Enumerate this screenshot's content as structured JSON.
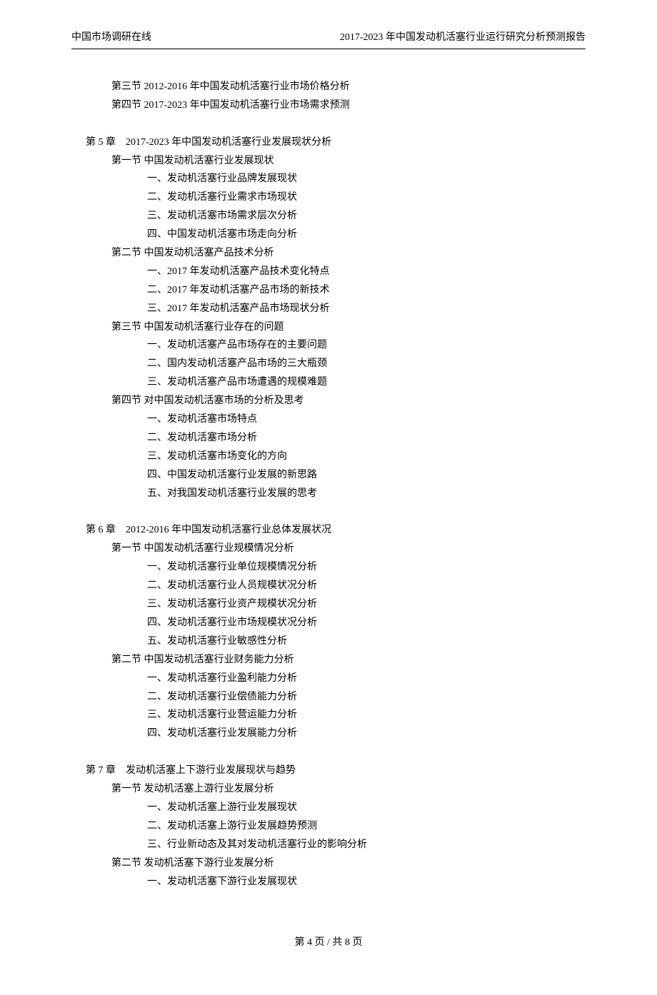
{
  "header": {
    "left": "中国市场调研在线",
    "right": "2017-2023 年中国发动机活塞行业运行研究分析预测报告"
  },
  "prelude": [
    {
      "type": "section",
      "text": "第三节 2012-2016 年中国发动机活塞行业市场价格分析"
    },
    {
      "type": "section",
      "text": "第四节 2017-2023 年中国发动机活塞行业市场需求预测"
    }
  ],
  "chapters": [
    {
      "title": "第 5 章　2017-2023 年中国发动机活塞行业发展现状分析",
      "sections": [
        {
          "title": "第一节 中国发动机活塞行业发展现状",
          "items": [
            "一、发动机活塞行业品牌发展现状",
            "二、发动机活塞行业需求市场现状",
            "三、发动机活塞市场需求层次分析",
            "四、中国发动机活塞市场走向分析"
          ]
        },
        {
          "title": "第二节 中国发动机活塞产品技术分析",
          "items": [
            "一、2017 年发动机活塞产品技术变化特点",
            "二、2017 年发动机活塞产品市场的新技术",
            "三、2017 年发动机活塞产品市场现状分析"
          ]
        },
        {
          "title": "第三节 中国发动机活塞行业存在的问题",
          "items": [
            "一、发动机活塞产品市场存在的主要问题",
            "二、国内发动机活塞产品市场的三大瓶颈",
            "三、发动机活塞产品市场遭遇的规模难题"
          ]
        },
        {
          "title": "第四节 对中国发动机活塞市场的分析及思考",
          "items": [
            "一、发动机活塞市场特点",
            "二、发动机活塞市场分析",
            "三、发动机活塞市场变化的方向",
            "四、中国发动机活塞行业发展的新思路",
            "五、对我国发动机活塞行业发展的思考"
          ]
        }
      ]
    },
    {
      "title": "第 6 章　2012-2016 年中国发动机活塞行业总体发展状况",
      "sections": [
        {
          "title": "第一节 中国发动机活塞行业规模情况分析",
          "items": [
            "一、发动机活塞行业单位规模情况分析",
            "二、发动机活塞行业人员规模状况分析",
            "三、发动机活塞行业资产规模状况分析",
            "四、发动机活塞行业市场规模状况分析",
            "五、发动机活塞行业敏感性分析"
          ]
        },
        {
          "title": "第二节 中国发动机活塞行业财务能力分析",
          "items": [
            "一、发动机活塞行业盈利能力分析",
            "二、发动机活塞行业偿债能力分析",
            "三、发动机活塞行业营运能力分析",
            "四、发动机活塞行业发展能力分析"
          ]
        }
      ]
    },
    {
      "title": "第 7 章　发动机活塞上下游行业发展现状与趋势",
      "sections": [
        {
          "title": "第一节 发动机活塞上游行业发展分析",
          "items": [
            "一、发动机活塞上游行业发展现状",
            "二、发动机活塞上游行业发展趋势预测",
            "三、行业新动态及其对发动机活塞行业的影响分析"
          ]
        },
        {
          "title": "第二节 发动机活塞下游行业发展分析",
          "items": [
            "一、发动机活塞下游行业发展现状"
          ]
        }
      ]
    }
  ],
  "footer": "第 4 页 / 共 8 页"
}
